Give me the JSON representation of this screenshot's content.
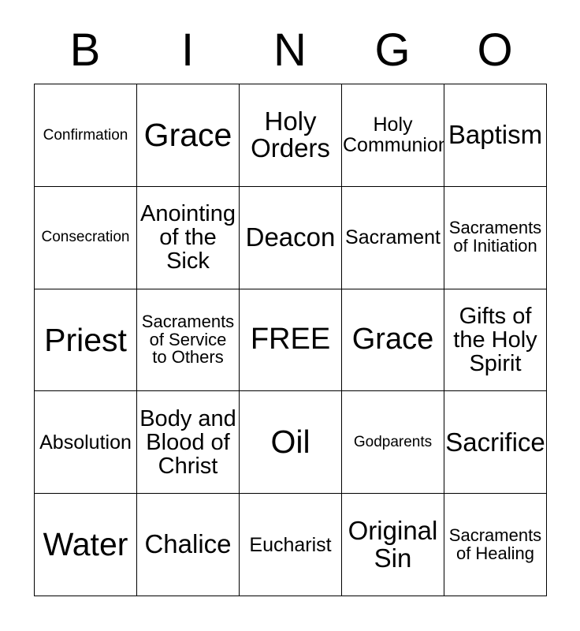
{
  "card": {
    "header_letters": [
      "B",
      "I",
      "N",
      "G",
      "O"
    ],
    "columns": 5,
    "rows": 5,
    "free_space_label": "FREE",
    "colors": {
      "background": "#ffffff",
      "border": "#000000",
      "text": "#000000"
    },
    "cells": [
      {
        "text": "Confirmation",
        "size": "fs-xxs"
      },
      {
        "text": "Grace",
        "size": "fs-xxl"
      },
      {
        "text": "Holy\nOrders",
        "size": "fs-l"
      },
      {
        "text": "Holy\nCommunion",
        "size": "fs-s"
      },
      {
        "text": "Baptism",
        "size": "fs-l"
      },
      {
        "text": "Consecration",
        "size": "fs-xxs"
      },
      {
        "text": "Anointing\nof the\nSick",
        "size": "fs-m"
      },
      {
        "text": "Deacon",
        "size": "fs-l"
      },
      {
        "text": "Sacrament",
        "size": "fs-s"
      },
      {
        "text": "Sacraments\nof Initiation",
        "size": "fs-xs"
      },
      {
        "text": "Priest",
        "size": "fs-xxl"
      },
      {
        "text": "Sacraments\nof Service\nto Others",
        "size": "fs-xs"
      },
      {
        "text": "FREE",
        "size": "fs-xl"
      },
      {
        "text": "Grace",
        "size": "fs-xl"
      },
      {
        "text": "Gifts of\nthe Holy\nSpirit",
        "size": "fs-m"
      },
      {
        "text": "Absolution",
        "size": "fs-s"
      },
      {
        "text": "Body and\nBlood of\nChrist",
        "size": "fs-m"
      },
      {
        "text": "Oil",
        "size": "fs-xxl"
      },
      {
        "text": "Godparents",
        "size": "fs-xxs"
      },
      {
        "text": "Sacrifice",
        "size": "fs-l"
      },
      {
        "text": "Water",
        "size": "fs-xxl"
      },
      {
        "text": "Chalice",
        "size": "fs-l"
      },
      {
        "text": "Eucharist",
        "size": "fs-s"
      },
      {
        "text": "Original\nSin",
        "size": "fs-l"
      },
      {
        "text": "Sacraments\nof Healing",
        "size": "fs-xs"
      }
    ]
  }
}
